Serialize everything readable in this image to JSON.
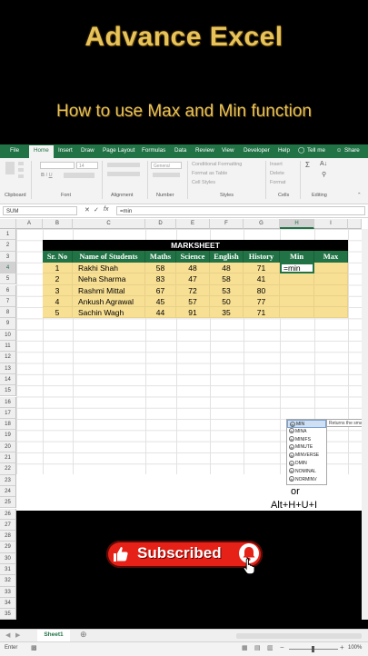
{
  "title": "Advance Excel",
  "subtitle": "How to use Max and Min function",
  "menubar": {
    "tabs": [
      "File",
      "Home",
      "Insert",
      "Draw",
      "Page Layout",
      "Formulas",
      "Data",
      "Review",
      "View",
      "Developer",
      "Help"
    ],
    "tell_me": "Tell me",
    "share": "Share"
  },
  "ribbon": {
    "groups": [
      "Clipboard",
      "Font",
      "Alignment",
      "Number",
      "Styles",
      "Cells",
      "Editing"
    ],
    "font_name": "",
    "font_size": "14",
    "number_format": "General",
    "conditional_formatting": "Conditional Formatting",
    "format_as_table": "Format as Table",
    "cell_styles": "Cell Styles",
    "insert": "Insert",
    "delete": "Delete",
    "format": "Format"
  },
  "formula_bar": {
    "name_box": "SUM",
    "fx": "fx",
    "formula": "=min"
  },
  "columns": [
    "A",
    "B",
    "C",
    "D",
    "E",
    "F",
    "G",
    "H",
    "I"
  ],
  "rows": [
    "1",
    "2",
    "3",
    "4",
    "5",
    "6",
    "7",
    "8",
    "9",
    "10",
    "11",
    "12",
    "13",
    "14",
    "15",
    "16",
    "17",
    "18",
    "19",
    "20",
    "21",
    "22",
    "23",
    "24",
    "25",
    "26",
    "27",
    "28",
    "29",
    "30",
    "31",
    "32",
    "33",
    "34",
    "35",
    "36"
  ],
  "marksheet": {
    "title": "MARKSHEET",
    "headers": [
      "Sr. No",
      "Name of Students",
      "Maths",
      "Science",
      "English",
      "History",
      "Min",
      "Max"
    ],
    "rows": [
      [
        "1",
        "Rakhi Shah",
        "58",
        "48",
        "48",
        "71"
      ],
      [
        "2",
        "Neha Sharma",
        "83",
        "47",
        "58",
        "41"
      ],
      [
        "3",
        "Rashmi Mittal",
        "67",
        "72",
        "53",
        "80"
      ],
      [
        "4",
        "Ankush Agrawal",
        "45",
        "57",
        "50",
        "77"
      ],
      [
        "5",
        "Sachin Wagh",
        "44",
        "91",
        "35",
        "71"
      ]
    ],
    "active_cell_value": "=min"
  },
  "autocomplete": {
    "items": [
      "MIN",
      "MINA",
      "MINIFS",
      "MINUTE",
      "MINVERSE",
      "DMIN",
      "NOMINAL",
      "NORMINV"
    ],
    "tooltip": "Returns the sma"
  },
  "or_text": "or",
  "shortcut": "Alt+H+U+I",
  "sheet_tab": "Sheet1",
  "status": {
    "mode": "Enter",
    "zoom": "100%"
  },
  "subscribe_button": "Subscribed",
  "colors": {
    "excel_green": "#217346",
    "cell_fill": "#f7df93",
    "title_gold": "#e8c35a",
    "subscribe_red": "#e62117"
  }
}
